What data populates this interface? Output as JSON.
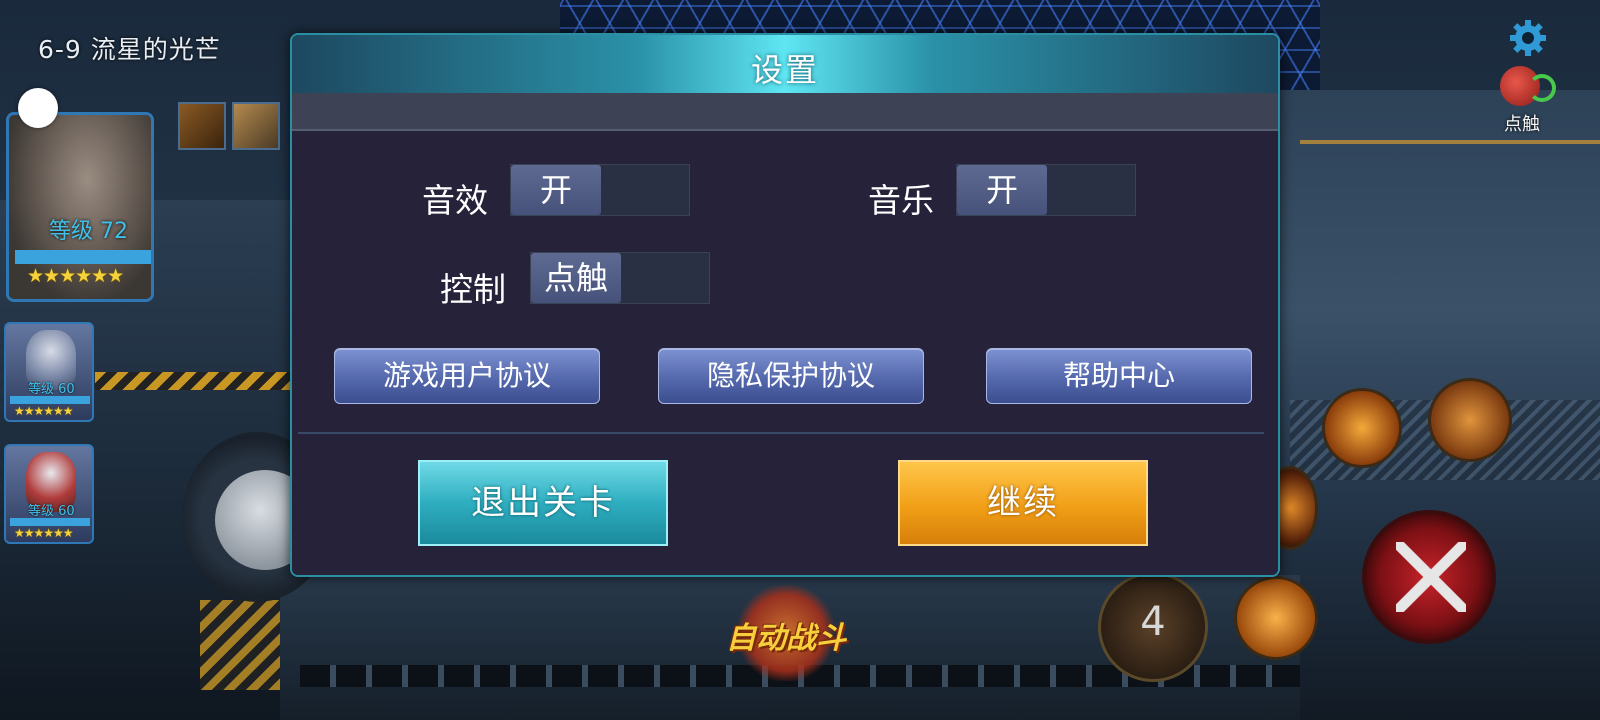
{
  "hud": {
    "stage_title": "6-9 流星的光芒",
    "tap_mode_label": "点触",
    "main_hero": {
      "level": "等级 72",
      "stars": "★★★★★★"
    },
    "team_heroes": [
      {
        "level": "等级 60",
        "stars": "★★★★★★"
      },
      {
        "level": "等级 60",
        "stars": "★★★★★★"
      }
    ],
    "skill_cooldown": "4",
    "auto_battle_label": "自动战斗"
  },
  "settings": {
    "title": "设置",
    "sound": {
      "label": "音效",
      "value": "开"
    },
    "music": {
      "label": "音乐",
      "value": "开"
    },
    "control": {
      "label": "控制",
      "value": "点触"
    },
    "links": {
      "user_agreement": "游戏用户协议",
      "privacy": "隐私保护协议",
      "help": "帮助中心"
    },
    "exit_label": "退出关卡",
    "continue_label": "继续"
  },
  "colors": {
    "header_accent": "#5fe6f2",
    "exit_button": "#2eaec0",
    "continue_button": "#f19f17",
    "link_button": "#5468ac",
    "toggle_knob": "#5e6a92"
  },
  "icons": [
    "gear-icon",
    "tap-hand-icon",
    "swords-icon"
  ]
}
